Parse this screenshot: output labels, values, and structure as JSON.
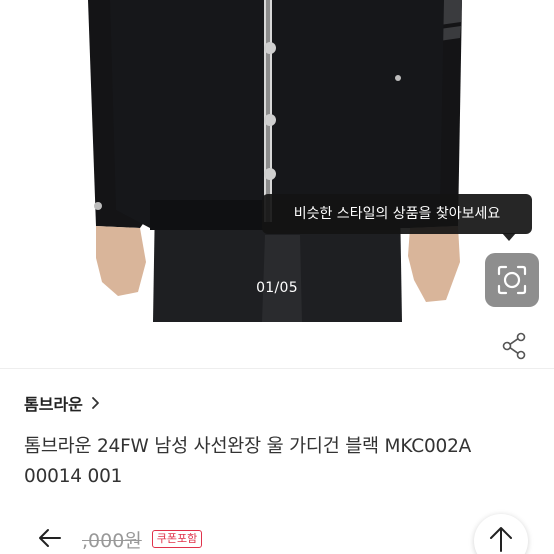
{
  "gallery": {
    "counter": "01/05",
    "tooltip": "비슷한 스타일의 상품을 찾아보세요",
    "lens_icon": "camera-lens-icon"
  },
  "product": {
    "shop_name": "톰브라운",
    "title": "톰브라운 24FW 남성 사선완장 울 가디건 블랙 MKC002A 00014 001",
    "price": ",000원",
    "coupon_badge": "쿠폰포함"
  },
  "icons": {
    "share": "share-icon",
    "chevron": "chevron-right-icon",
    "back": "arrow-left-icon",
    "top": "arrow-up-icon"
  },
  "colors": {
    "badge": "#e0324b",
    "tooltip_bg": "#141414"
  }
}
